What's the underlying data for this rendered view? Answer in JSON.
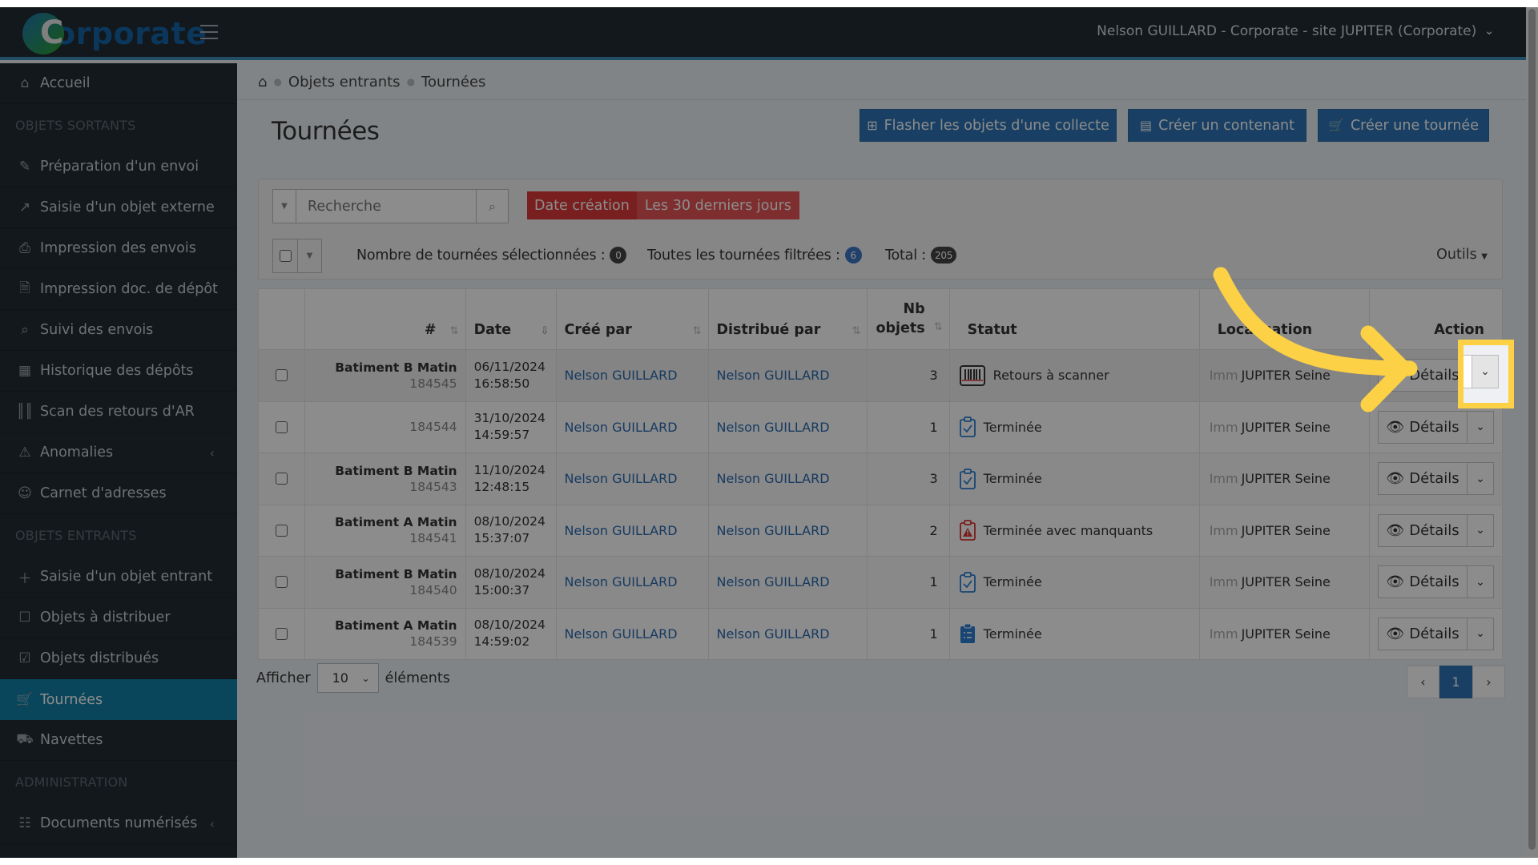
{
  "app": {
    "logo_letter": "C",
    "logo_rest": "orporate"
  },
  "header": {
    "user_menu": "Nelson GUILLARD - Corporate - site JUPITER (Corporate)"
  },
  "sidebar": {
    "home": "Accueil",
    "section_out": "OBJETS SORTANTS",
    "out_items": [
      {
        "label": "Préparation d'un envoi",
        "icon": "pencil-icon"
      },
      {
        "label": "Saisie d'un objet externe",
        "icon": "external-edit-icon"
      },
      {
        "label": "Impression des envois",
        "icon": "printer-icon"
      },
      {
        "label": "Impression doc. de dépôt",
        "icon": "document-icon"
      },
      {
        "label": "Suivi des envois",
        "icon": "search-icon"
      },
      {
        "label": "Historique des dépôts",
        "icon": "calendar-icon"
      },
      {
        "label": "Scan des retours d'AR",
        "icon": "barcode-icon"
      },
      {
        "label": "Anomalies",
        "icon": "warning-icon"
      },
      {
        "label": "Carnet d'adresses",
        "icon": "users-icon"
      }
    ],
    "section_in": "OBJETS ENTRANTS",
    "in_items": [
      {
        "label": "Saisie d'un objet entrant",
        "icon": "plus-icon"
      },
      {
        "label": "Objets à distribuer",
        "icon": "square-icon"
      },
      {
        "label": "Objets distribués",
        "icon": "checkbox-icon"
      },
      {
        "label": "Tournées",
        "icon": "cart-icon",
        "active": true
      },
      {
        "label": "Navettes",
        "icon": "truck-icon"
      }
    ],
    "section_admin": "ADMINISTRATION",
    "admin_items": [
      {
        "label": "Documents numérisés",
        "icon": "qrcode-icon"
      }
    ]
  },
  "breadcrumb": {
    "items": [
      "Objets entrants",
      "Tournées"
    ]
  },
  "page": {
    "title": "Tournées",
    "buttons": {
      "flash": "Flasher les objets d'une collecte",
      "container": "Créer un contenant",
      "tour": "Créer une tournée"
    }
  },
  "filters": {
    "search_placeholder": "Recherche",
    "date_label": "Date création",
    "date_value": "Les 30 derniers jours",
    "selected_label": "Nombre de tournées sélectionnées :",
    "selected_count": "0",
    "filtered_label": "Toutes les tournées filtrées :",
    "filtered_count": "6",
    "total_label": "Total :",
    "total_count": "205",
    "tools": "Outils"
  },
  "table": {
    "columns": {
      "id": "#",
      "date": "Date",
      "created_by": "Créé par",
      "distributed_by": "Distribué par",
      "nb_line1": "Nb",
      "nb_line2": "objets",
      "status": "Statut",
      "location": "Localisation",
      "action": "Action"
    },
    "rows": [
      {
        "name": "Batiment B Matin",
        "id": "184545",
        "date": "06/11/2024",
        "time": "16:58:50",
        "created_by": "Nelson GUILLARD",
        "distributed_by": "Nelson GUILLARD",
        "nb": "3",
        "status": "Retours à scanner",
        "status_icon": "barcode-scan-icon",
        "loc_prefix": "Imm",
        "loc": "JUPITER Seine",
        "action": "Détails"
      },
      {
        "name": "",
        "id": "184544",
        "date": "31/10/2024",
        "time": "14:59:57",
        "created_by": "Nelson GUILLARD",
        "distributed_by": "Nelson GUILLARD",
        "nb": "1",
        "status": "Terminée",
        "status_icon": "clipboard-check-icon",
        "loc_prefix": "Imm",
        "loc": "JUPITER Seine",
        "action": "Détails"
      },
      {
        "name": "Batiment B Matin",
        "id": "184543",
        "date": "11/10/2024",
        "time": "12:48:15",
        "created_by": "Nelson GUILLARD",
        "distributed_by": "Nelson GUILLARD",
        "nb": "3",
        "status": "Terminée",
        "status_icon": "clipboard-check-icon",
        "loc_prefix": "Imm",
        "loc": "JUPITER Seine",
        "action": "Détails"
      },
      {
        "name": "Batiment A Matin",
        "id": "184541",
        "date": "08/10/2024",
        "time": "15:37:07",
        "created_by": "Nelson GUILLARD",
        "distributed_by": "Nelson GUILLARD",
        "nb": "2",
        "status": "Terminée avec manquants",
        "status_icon": "clipboard-warning-icon",
        "loc_prefix": "Imm",
        "loc": "JUPITER Seine",
        "action": "Détails"
      },
      {
        "name": "Batiment B Matin",
        "id": "184540",
        "date": "08/10/2024",
        "time": "15:00:37",
        "created_by": "Nelson GUILLARD",
        "distributed_by": "Nelson GUILLARD",
        "nb": "1",
        "status": "Terminée",
        "status_icon": "clipboard-check-icon",
        "loc_prefix": "Imm",
        "loc": "JUPITER Seine",
        "action": "Détails"
      },
      {
        "name": "Batiment A Matin",
        "id": "184539",
        "date": "08/10/2024",
        "time": "14:59:02",
        "created_by": "Nelson GUILLARD",
        "distributed_by": "Nelson GUILLARD",
        "nb": "1",
        "status": "Terminée",
        "status_icon": "clipboard-list-icon",
        "loc_prefix": "Imm",
        "loc": "JUPITER Seine",
        "action": "Détails"
      }
    ]
  },
  "footer": {
    "show_label": "Afficher",
    "page_size": "10",
    "elements_label": "éléments",
    "current_page": "1"
  },
  "colors": {
    "accent": "#3c8dbc",
    "primary_button": "#2e75b6",
    "danger_filter": "#dd3a3a",
    "annotation": "#fdd145"
  }
}
